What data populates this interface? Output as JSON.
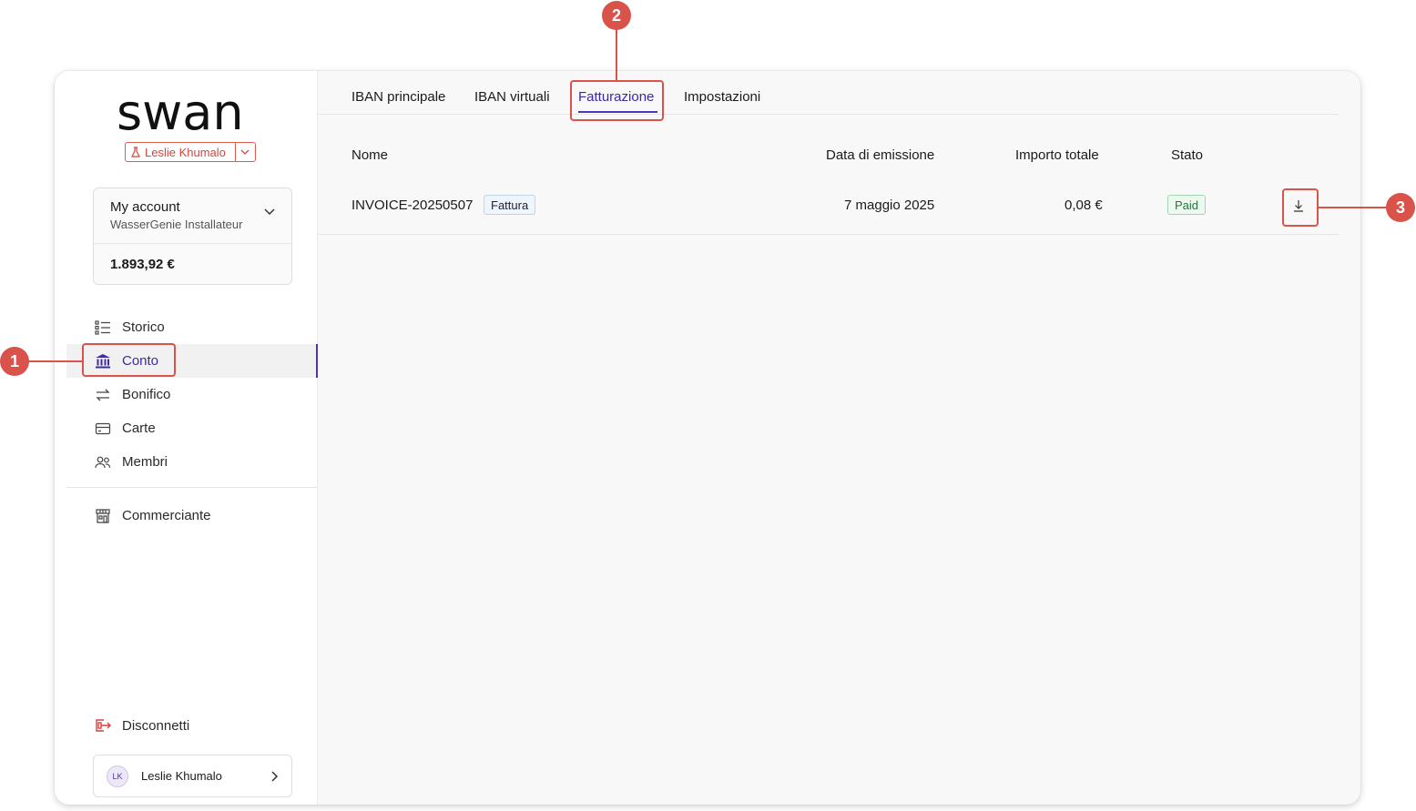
{
  "brand": {
    "logo_text": "swan",
    "user_pill": "Leslie Khumalo"
  },
  "account": {
    "title": "My account",
    "subtitle": "WasserGenie Installateur",
    "balance": "1.893,92 €"
  },
  "nav": {
    "items": [
      {
        "label": "Storico",
        "icon": "list-icon"
      },
      {
        "label": "Conto",
        "icon": "bank-icon"
      },
      {
        "label": "Bonifico",
        "icon": "transfer-arrows-icon"
      },
      {
        "label": "Carte",
        "icon": "card-icon"
      },
      {
        "label": "Membri",
        "icon": "members-icon"
      }
    ],
    "merchant": "Commerciante",
    "logout": "Disconnetti"
  },
  "profile": {
    "initials": "LK",
    "name": "Leslie Khumalo"
  },
  "tabs": [
    "IBAN principale",
    "IBAN virtuali",
    "Fatturazione",
    "Impostazioni"
  ],
  "table": {
    "headers": [
      "Nome",
      "Data di emissione",
      "Importo totale",
      "Stato"
    ],
    "rows": [
      {
        "name": "INVOICE-20250507",
        "type": "Fattura",
        "date": "7 maggio 2025",
        "amount": "0,08 €",
        "status": "Paid"
      }
    ]
  },
  "callouts": [
    "1",
    "2",
    "3"
  ],
  "colors": {
    "accent": "#4b35b8",
    "highlight": "#d9534a"
  }
}
